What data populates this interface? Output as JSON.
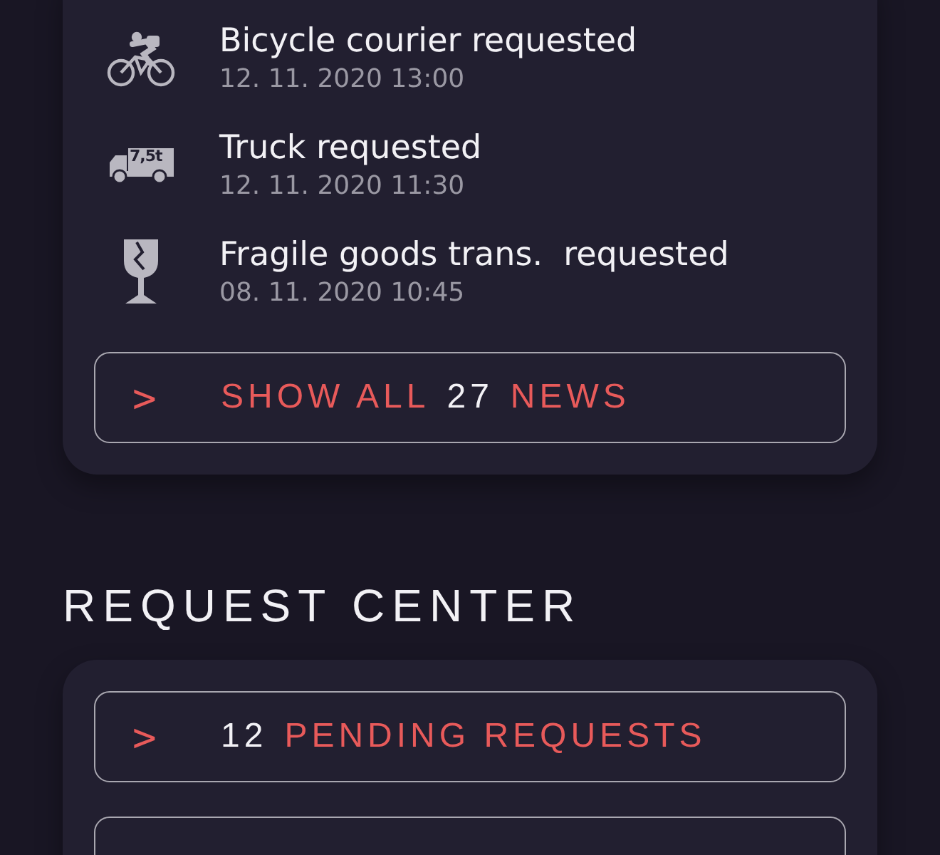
{
  "news": {
    "items": [
      {
        "kind": "bicycle",
        "title": "Bicycle courier requested",
        "time": "12. 11. 2020 13:00"
      },
      {
        "kind": "truck",
        "icon_label": "7,5t",
        "title": "Truck requested",
        "time": "12. 11. 2020 11:30"
      },
      {
        "kind": "glass",
        "title": "Fragile goods trans.  requested",
        "time": "08. 11. 2020 10:45"
      }
    ],
    "button": {
      "chevron": ">",
      "parts": [
        {
          "kind": "label",
          "text": "SHOW ALL"
        },
        {
          "kind": "count",
          "text": "27"
        },
        {
          "kind": "label",
          "text": "NEWS"
        }
      ]
    }
  },
  "request_center": {
    "heading": "REQUEST CENTER",
    "buttons": [
      {
        "chevron": ">",
        "parts": [
          {
            "kind": "count",
            "text": "12"
          },
          {
            "kind": "label",
            "text": "PENDING REQUESTS"
          }
        ]
      }
    ],
    "more_below": true
  }
}
